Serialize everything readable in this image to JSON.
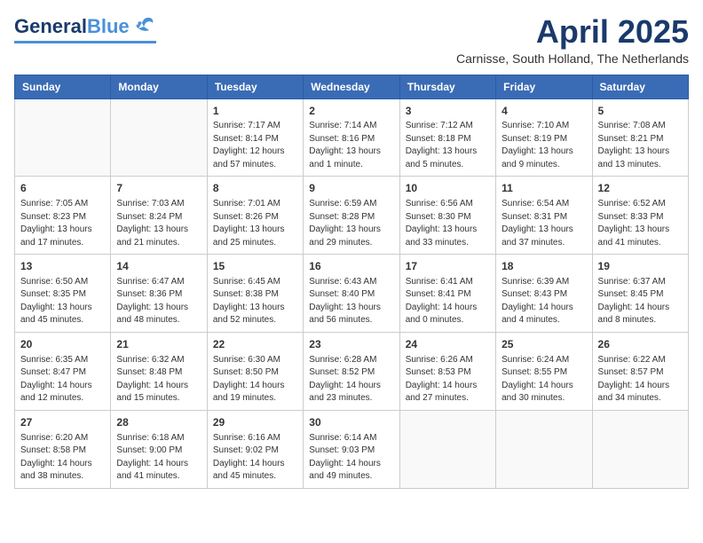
{
  "header": {
    "logo_general": "General",
    "logo_blue": "Blue",
    "title": "April 2025",
    "subtitle": "Carnisse, South Holland, The Netherlands"
  },
  "weekdays": [
    "Sunday",
    "Monday",
    "Tuesday",
    "Wednesday",
    "Thursday",
    "Friday",
    "Saturday"
  ],
  "weeks": [
    [
      {
        "day": "",
        "info": ""
      },
      {
        "day": "",
        "info": ""
      },
      {
        "day": "1",
        "info": "Sunrise: 7:17 AM\nSunset: 8:14 PM\nDaylight: 12 hours and 57 minutes."
      },
      {
        "day": "2",
        "info": "Sunrise: 7:14 AM\nSunset: 8:16 PM\nDaylight: 13 hours and 1 minute."
      },
      {
        "day": "3",
        "info": "Sunrise: 7:12 AM\nSunset: 8:18 PM\nDaylight: 13 hours and 5 minutes."
      },
      {
        "day": "4",
        "info": "Sunrise: 7:10 AM\nSunset: 8:19 PM\nDaylight: 13 hours and 9 minutes."
      },
      {
        "day": "5",
        "info": "Sunrise: 7:08 AM\nSunset: 8:21 PM\nDaylight: 13 hours and 13 minutes."
      }
    ],
    [
      {
        "day": "6",
        "info": "Sunrise: 7:05 AM\nSunset: 8:23 PM\nDaylight: 13 hours and 17 minutes."
      },
      {
        "day": "7",
        "info": "Sunrise: 7:03 AM\nSunset: 8:24 PM\nDaylight: 13 hours and 21 minutes."
      },
      {
        "day": "8",
        "info": "Sunrise: 7:01 AM\nSunset: 8:26 PM\nDaylight: 13 hours and 25 minutes."
      },
      {
        "day": "9",
        "info": "Sunrise: 6:59 AM\nSunset: 8:28 PM\nDaylight: 13 hours and 29 minutes."
      },
      {
        "day": "10",
        "info": "Sunrise: 6:56 AM\nSunset: 8:30 PM\nDaylight: 13 hours and 33 minutes."
      },
      {
        "day": "11",
        "info": "Sunrise: 6:54 AM\nSunset: 8:31 PM\nDaylight: 13 hours and 37 minutes."
      },
      {
        "day": "12",
        "info": "Sunrise: 6:52 AM\nSunset: 8:33 PM\nDaylight: 13 hours and 41 minutes."
      }
    ],
    [
      {
        "day": "13",
        "info": "Sunrise: 6:50 AM\nSunset: 8:35 PM\nDaylight: 13 hours and 45 minutes."
      },
      {
        "day": "14",
        "info": "Sunrise: 6:47 AM\nSunset: 8:36 PM\nDaylight: 13 hours and 48 minutes."
      },
      {
        "day": "15",
        "info": "Sunrise: 6:45 AM\nSunset: 8:38 PM\nDaylight: 13 hours and 52 minutes."
      },
      {
        "day": "16",
        "info": "Sunrise: 6:43 AM\nSunset: 8:40 PM\nDaylight: 13 hours and 56 minutes."
      },
      {
        "day": "17",
        "info": "Sunrise: 6:41 AM\nSunset: 8:41 PM\nDaylight: 14 hours and 0 minutes."
      },
      {
        "day": "18",
        "info": "Sunrise: 6:39 AM\nSunset: 8:43 PM\nDaylight: 14 hours and 4 minutes."
      },
      {
        "day": "19",
        "info": "Sunrise: 6:37 AM\nSunset: 8:45 PM\nDaylight: 14 hours and 8 minutes."
      }
    ],
    [
      {
        "day": "20",
        "info": "Sunrise: 6:35 AM\nSunset: 8:47 PM\nDaylight: 14 hours and 12 minutes."
      },
      {
        "day": "21",
        "info": "Sunrise: 6:32 AM\nSunset: 8:48 PM\nDaylight: 14 hours and 15 minutes."
      },
      {
        "day": "22",
        "info": "Sunrise: 6:30 AM\nSunset: 8:50 PM\nDaylight: 14 hours and 19 minutes."
      },
      {
        "day": "23",
        "info": "Sunrise: 6:28 AM\nSunset: 8:52 PM\nDaylight: 14 hours and 23 minutes."
      },
      {
        "day": "24",
        "info": "Sunrise: 6:26 AM\nSunset: 8:53 PM\nDaylight: 14 hours and 27 minutes."
      },
      {
        "day": "25",
        "info": "Sunrise: 6:24 AM\nSunset: 8:55 PM\nDaylight: 14 hours and 30 minutes."
      },
      {
        "day": "26",
        "info": "Sunrise: 6:22 AM\nSunset: 8:57 PM\nDaylight: 14 hours and 34 minutes."
      }
    ],
    [
      {
        "day": "27",
        "info": "Sunrise: 6:20 AM\nSunset: 8:58 PM\nDaylight: 14 hours and 38 minutes."
      },
      {
        "day": "28",
        "info": "Sunrise: 6:18 AM\nSunset: 9:00 PM\nDaylight: 14 hours and 41 minutes."
      },
      {
        "day": "29",
        "info": "Sunrise: 6:16 AM\nSunset: 9:02 PM\nDaylight: 14 hours and 45 minutes."
      },
      {
        "day": "30",
        "info": "Sunrise: 6:14 AM\nSunset: 9:03 PM\nDaylight: 14 hours and 49 minutes."
      },
      {
        "day": "",
        "info": ""
      },
      {
        "day": "",
        "info": ""
      },
      {
        "day": "",
        "info": ""
      }
    ]
  ]
}
